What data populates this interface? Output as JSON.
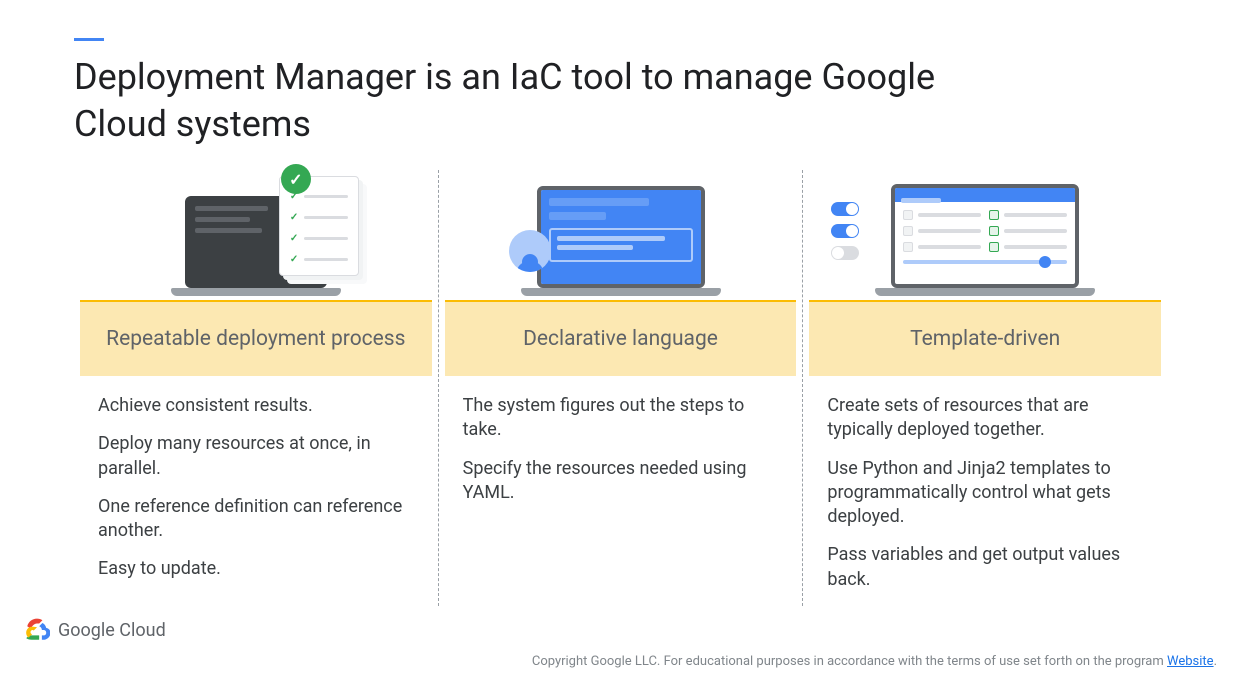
{
  "title": "Deployment Manager is an IaC tool to manage Google Cloud systems",
  "columns": [
    {
      "heading": "Repeatable deployment process",
      "bullets": [
        "Achieve consistent results.",
        "Deploy many resources at once, in parallel.",
        "One reference definition can reference another.",
        "Easy to update."
      ]
    },
    {
      "heading": "Declarative language",
      "bullets": [
        "The system figures out the steps to take.",
        "Specify the resources needed using YAML."
      ]
    },
    {
      "heading": "Template-driven",
      "bullets": [
        "Create sets of resources that are typically deployed together.",
        "Use Python and Jinja2 templates to programmatically control what gets deployed.",
        "Pass variables and get output values back."
      ]
    }
  ],
  "footer": {
    "brand": "Google Cloud",
    "copyright": "Copyright Google LLC. For educational purposes in accordance with the terms of use set forth on the program ",
    "link_text": "Website"
  }
}
